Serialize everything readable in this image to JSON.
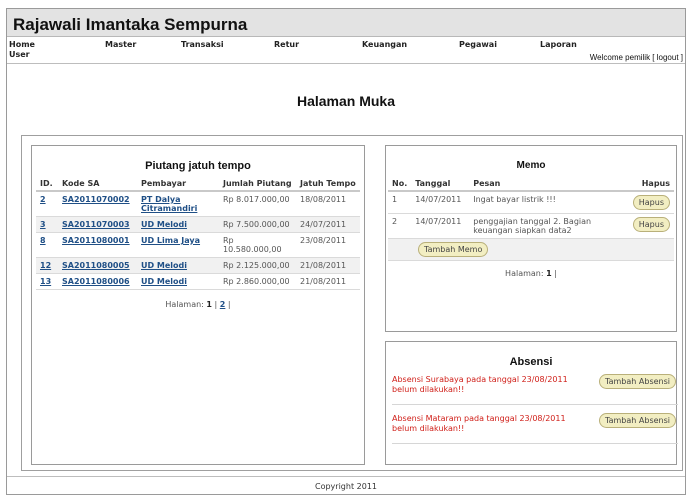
{
  "app": {
    "title": "Rajawali Imantaka Sempurna"
  },
  "menu": {
    "items": [
      "Home",
      "User",
      "Master",
      "Transaksi",
      "Retur",
      "Keuangan",
      "Pegawai",
      "Laporan"
    ],
    "welcome": "Welcome pemilik [ logout ]"
  },
  "page": {
    "heading": "Halaman Muka"
  },
  "piutang": {
    "title": "Piutang jatuh tempo",
    "columns": [
      "ID.",
      "Kode SA",
      "Pembayar",
      "Jumlah Piutang",
      "Jatuh Tempo"
    ],
    "rows": [
      {
        "id": "2",
        "kode": "SA2011070002",
        "pembayar": "PT Dalya Citramandiri",
        "jumlah": "Rp 8.017.000,00",
        "tempo": "18/08/2011"
      },
      {
        "id": "3",
        "kode": "SA2011070003",
        "pembayar": "UD Melodi",
        "jumlah": "Rp 7.500.000,00",
        "tempo": "24/07/2011"
      },
      {
        "id": "8",
        "kode": "SA2011080001",
        "pembayar": "UD Lima Jaya",
        "jumlah": "Rp 10.580.000,00",
        "tempo": "23/08/2011"
      },
      {
        "id": "12",
        "kode": "SA2011080005",
        "pembayar": "UD Melodi",
        "jumlah": "Rp 2.125.000,00",
        "tempo": "21/08/2011"
      },
      {
        "id": "13",
        "kode": "SA2011080006",
        "pembayar": "UD Melodi",
        "jumlah": "Rp 2.860.000,00",
        "tempo": "21/08/2011"
      }
    ],
    "pager_label": "Halaman:",
    "pages": [
      "1",
      "2"
    ]
  },
  "memo": {
    "title": "Memo",
    "columns": [
      "No.",
      "Tanggal",
      "Pesan",
      "Hapus"
    ],
    "rows": [
      {
        "no": "1",
        "tanggal": "14/07/2011",
        "pesan": "Ingat bayar listrik !!!",
        "action": "Hapus"
      },
      {
        "no": "2",
        "tanggal": "14/07/2011",
        "pesan": "penggajian tanggal 2. Bagian keuangan siapkan data2",
        "action": "Hapus"
      }
    ],
    "add_label": "Tambah Memo",
    "pager_label": "Halaman:",
    "pages": [
      "1"
    ]
  },
  "absensi": {
    "title": "Absensi",
    "rows": [
      {
        "message": "Absensi Surabaya pada tanggal 23/08/2011 belum dilakukan!!",
        "action": "Tambah Absensi"
      },
      {
        "message": "Absensi Mataram pada tanggal 23/08/2011 belum dilakukan!!",
        "action": "Tambah Absensi"
      }
    ]
  },
  "footer": {
    "text": "Copyright 2011"
  }
}
